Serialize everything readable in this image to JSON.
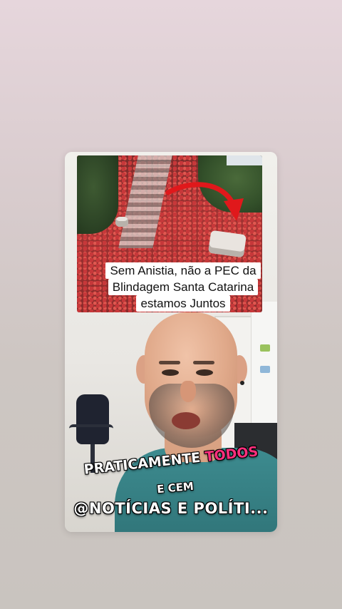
{
  "caption": {
    "line1": "Sem Anistia, não a PEC da",
    "line2": "Blindagem Santa Catarina",
    "line3": "estamos Juntos"
  },
  "overlay": {
    "line1_prefix": "PRATICAMENTE ",
    "line1_highlight": "TODOS",
    "line2": "E CEM",
    "line3": "@NOTÍCIAS E POLÍTI..."
  },
  "colors": {
    "highlight": "#ff2f7d",
    "arrow": "#e0181b",
    "shirt": "#3d8b8f"
  }
}
